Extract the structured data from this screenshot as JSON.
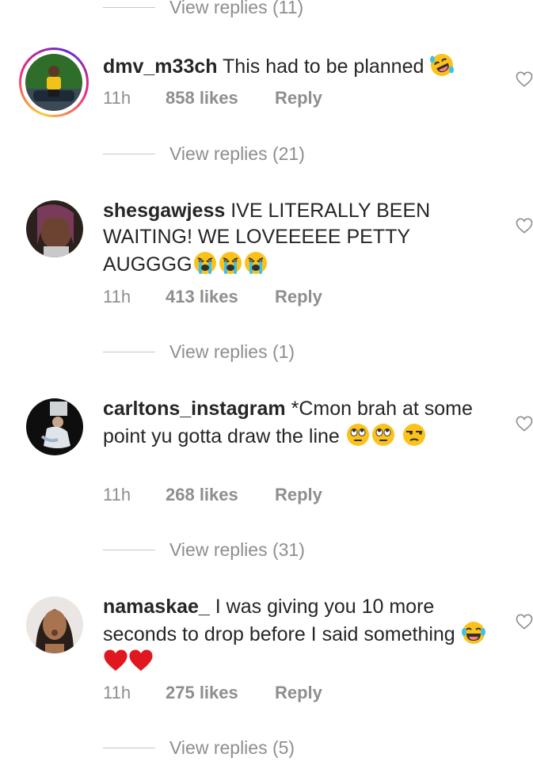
{
  "top_view_replies": "View replies (11)",
  "comments": [
    {
      "username": "dmv_m33ch",
      "text": "This had to be planned",
      "emojis": [
        "rolling-laughing"
      ],
      "time": "11h",
      "likes": "858 likes",
      "reply": "Reply",
      "view_replies": "View replies (21)",
      "has_story_ring": true
    },
    {
      "username": "shesgawjess",
      "text": "IVE LITERALLY BEEN WAITING! WE LOVEEEEE PETTY AUGGGG",
      "emojis": [
        "loudly-crying",
        "loudly-crying",
        "loudly-crying"
      ],
      "time": "11h",
      "likes": "413 likes",
      "reply": "Reply",
      "view_replies": "View replies (1)",
      "has_story_ring": false
    },
    {
      "username": "carltons_instagram",
      "text": "*Cmon brah at some point yu gotta draw the line",
      "emojis": [
        "eye-roll",
        "eye-roll",
        "unamused"
      ],
      "time": "11h",
      "likes": "268 likes",
      "reply": "Reply",
      "view_replies": "View replies (31)",
      "has_story_ring": false
    },
    {
      "username": "namaskae_",
      "text": "I was giving you 10 more seconds to drop before I said something",
      "emojis": [
        "tears-of-joy",
        "red-heart",
        "red-heart"
      ],
      "time": "11h",
      "likes": "275 likes",
      "reply": "Reply",
      "view_replies": "View replies (5)",
      "has_story_ring": false
    }
  ],
  "colors": {
    "primary_text": "#262626",
    "secondary_text": "#8e8e8e",
    "divider": "#c7c7c7"
  }
}
